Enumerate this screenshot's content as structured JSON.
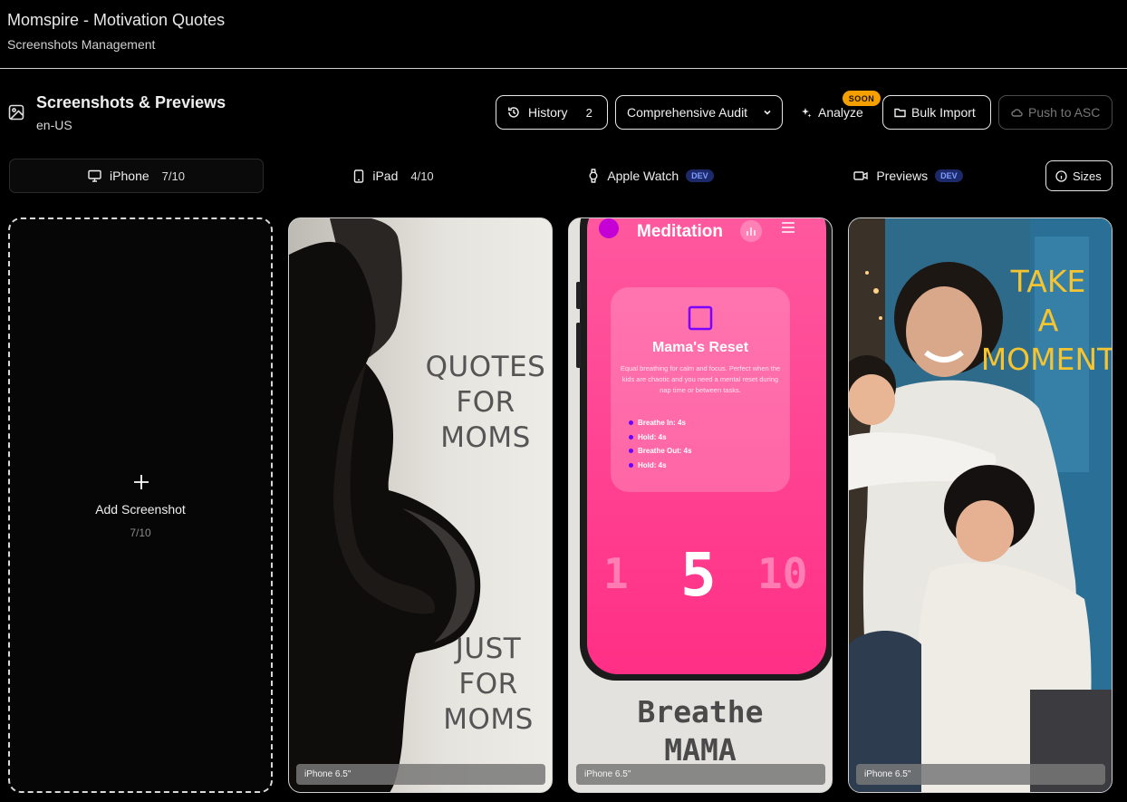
{
  "header": {
    "title": "Momspire - Motivation Quotes",
    "subtitle": "Screenshots Management"
  },
  "section": {
    "title": "Screenshots & Previews",
    "locale": "en-US"
  },
  "toolbar": {
    "history_label": "History",
    "history_count": "2",
    "audit_label": "Comprehensive Audit",
    "analyze_label": "Analyze",
    "analyze_badge": "SOON",
    "bulk_import_label": "Bulk Import",
    "push_label": "Push to ASC"
  },
  "device_tabs": [
    {
      "label": "iPhone",
      "count": "7/10",
      "active": true
    },
    {
      "label": "iPad",
      "count": "4/10"
    },
    {
      "label": "Apple Watch",
      "badge": "DEV"
    },
    {
      "label": "Previews",
      "badge": "DEV"
    }
  ],
  "sizes_label": "Sizes",
  "add_card": {
    "label": "Add Screenshot",
    "count": "7/10"
  },
  "screenshots": [
    {
      "caption": "iPhone 6.5\"",
      "text_top": [
        "QUOTES",
        "FOR",
        "MOMS"
      ],
      "text_bottom": [
        "JUST",
        "FOR",
        "MOMS"
      ]
    },
    {
      "caption": "iPhone 6.5\"",
      "app_title": "Meditation",
      "card_title": "Mama's Reset",
      "card_desc": "Equal breathing for calm and focus. Perfect when the kids are chaotic and you need a mental reset during nap time or between tasks.",
      "steps": [
        "Breathe In: 4s",
        "Hold: 4s",
        "Breathe Out: 4s",
        "Hold: 4s"
      ],
      "counter_prev": "1",
      "counter_main": "5",
      "counter_next": "10",
      "footer_text": [
        "Breathe",
        "MAMA"
      ]
    },
    {
      "caption": "iPhone 6.5\"",
      "text": [
        "TAKE",
        "A",
        "MOMENT"
      ]
    }
  ],
  "colors": {
    "background": "#000000",
    "soon_badge": "#f5a000",
    "dev_badge_bg": "#1c2a6b",
    "dev_badge_text": "#7f9cff",
    "meditation_pink": "#ff3f8e",
    "moment_yellow": "#f5c431"
  }
}
